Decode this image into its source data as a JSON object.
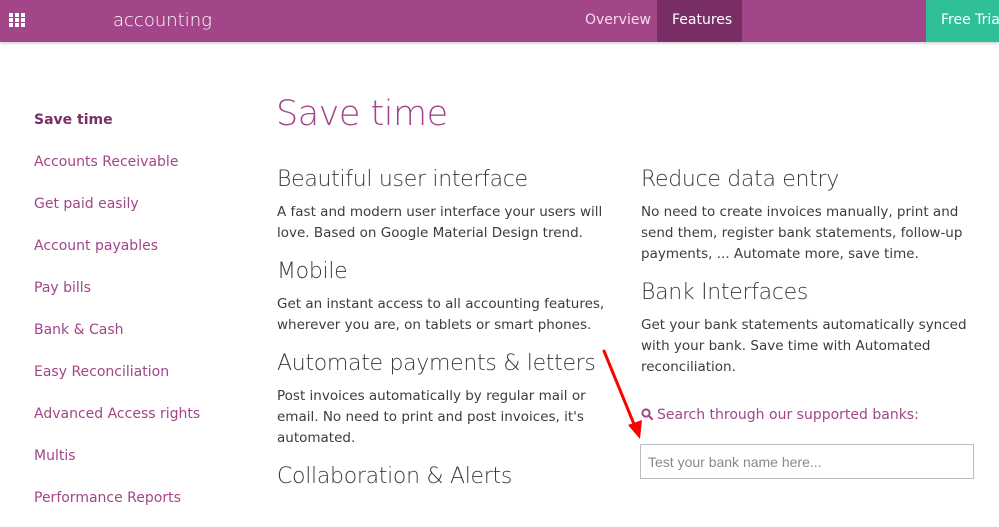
{
  "header": {
    "brand": "accounting",
    "nav": [
      {
        "label": "Overview"
      },
      {
        "label": "Features"
      }
    ],
    "cta": "Free Trial"
  },
  "sidebar": {
    "items": [
      {
        "label": "Save time"
      },
      {
        "label": "Accounts Receivable"
      },
      {
        "label": "Get paid easily"
      },
      {
        "label": "Account payables"
      },
      {
        "label": "Pay bills"
      },
      {
        "label": "Bank & Cash"
      },
      {
        "label": "Easy Reconciliation"
      },
      {
        "label": "Advanced Access rights"
      },
      {
        "label": "Multis"
      },
      {
        "label": "Performance Reports"
      }
    ]
  },
  "main": {
    "title": "Save time",
    "left": [
      {
        "heading": "Beautiful user interface",
        "text": "A fast and modern user interface your users will love. Based on Google Material Design trend."
      },
      {
        "heading": "Mobile",
        "text": "Get an instant access to all accounting features, wherever you are, on tablets or smart phones."
      },
      {
        "heading": "Automate payments & letters",
        "text": "Post invoices automatically by regular mail or email. No need to print and post invoices, it's automated."
      },
      {
        "heading": "Collaboration & Alerts",
        "text": ""
      }
    ],
    "right": [
      {
        "heading": "Reduce data entry",
        "text": "No need to create invoices manually, print and send them, register bank statements, follow-up payments, ... Automate more, save time."
      },
      {
        "heading": "Bank Interfaces",
        "text": "Get your bank statements automatically synced with your bank. Save time with Automated reconciliation."
      }
    ],
    "bank_search": {
      "label": "Search through our supported banks:",
      "placeholder": "Test your bank name here..."
    }
  },
  "colors": {
    "primary": "#a24689",
    "nav_active": "#7a2e66",
    "cta": "#2fc09a",
    "annotation_arrow": "#ff0000"
  }
}
